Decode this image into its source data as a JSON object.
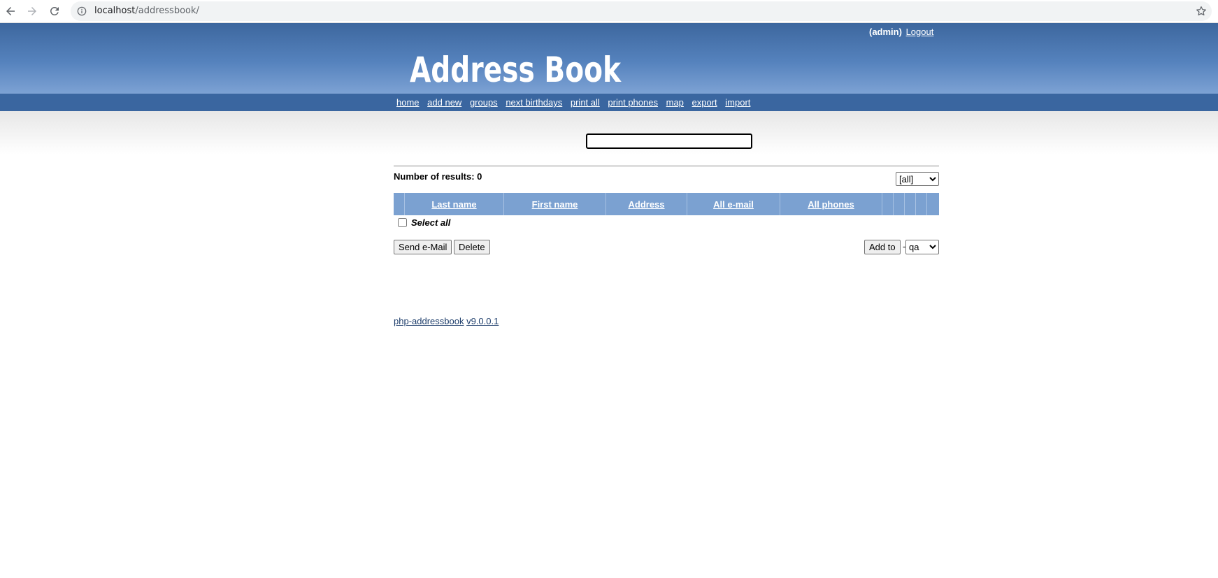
{
  "browser": {
    "url_host": "localhost",
    "url_path": "/addressbook/"
  },
  "header": {
    "user": "(admin)",
    "logout": "Logout",
    "title": "Address Book"
  },
  "nav": {
    "items": [
      "home",
      "add new",
      "groups",
      "next birthdays",
      "print all",
      "print phones",
      "map",
      "export",
      "import"
    ]
  },
  "search": {
    "value": ""
  },
  "results": {
    "label": "Number of results: 0",
    "group_filter": "[all]"
  },
  "table": {
    "columns": [
      "",
      "Last name",
      "First name",
      "Address",
      "All e-mail",
      "All phones",
      "",
      "",
      "",
      "",
      ""
    ]
  },
  "select_all": "Select all",
  "actions": {
    "send_email": "Send e-Mail",
    "delete": "Delete",
    "add_to": "Add to",
    "dash": "-",
    "target_group": "qa"
  },
  "footer": {
    "app": "php-addressbook",
    "version": "v9.0.0.1"
  }
}
